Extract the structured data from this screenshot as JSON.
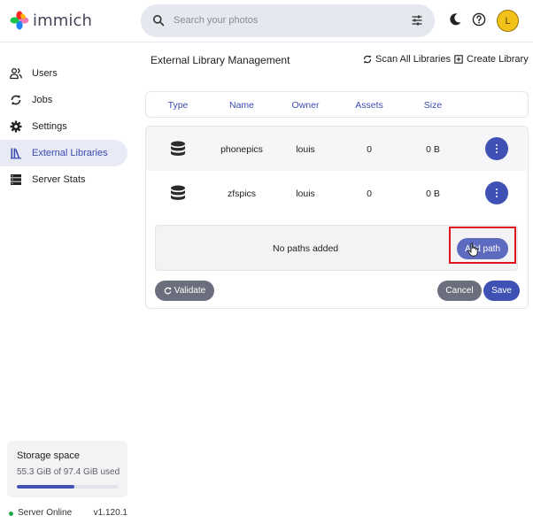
{
  "app": {
    "logo_text": "immich"
  },
  "search": {
    "placeholder": "Search your photos"
  },
  "header": {
    "avatar_initial": "L"
  },
  "sidebar": {
    "items": [
      {
        "label": "Users",
        "icon": "users-icon",
        "active": false
      },
      {
        "label": "Jobs",
        "icon": "sync-icon",
        "active": false
      },
      {
        "label": "Settings",
        "icon": "gear-icon",
        "active": false
      },
      {
        "label": "External Libraries",
        "icon": "library-icon",
        "active": true
      },
      {
        "label": "Server Stats",
        "icon": "server-icon",
        "active": false
      }
    ],
    "storage": {
      "title": "Storage space",
      "used_text": "55.3 GiB of 97.4 GiB used",
      "used_fraction": 0.568
    },
    "server": {
      "status": "Server Online",
      "version": "v1.120.1"
    }
  },
  "main": {
    "title": "External Library Management",
    "scan_all_label": "Scan All Libraries",
    "create_label": "Create Library",
    "columns": [
      "Type",
      "Name",
      "Owner",
      "Assets",
      "Size"
    ],
    "libraries": [
      {
        "name": "phonepics",
        "owner": "louis",
        "assets": "0",
        "size": "0 B"
      },
      {
        "name": "zfspics",
        "owner": "louis",
        "assets": "0",
        "size": "0 B"
      }
    ],
    "paths_empty_text": "No paths added",
    "add_path_label": "Add path",
    "validate_label": "Validate",
    "cancel_label": "Cancel",
    "save_label": "Save"
  },
  "colors": {
    "accent": "#3f51b5",
    "highlight": "#e0141e",
    "online": "#22a64a"
  }
}
